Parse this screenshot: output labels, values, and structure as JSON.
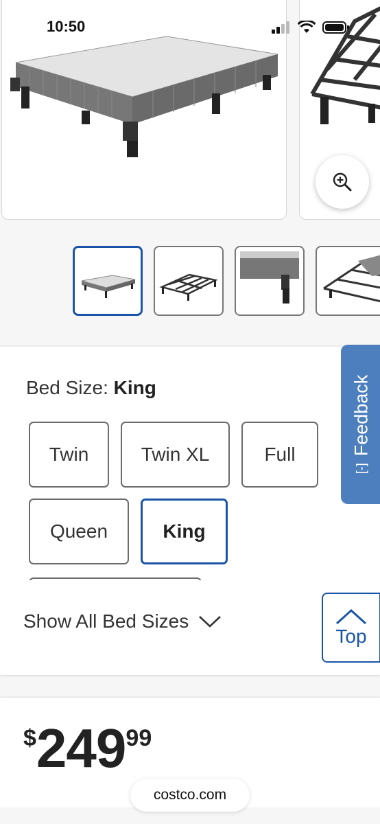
{
  "status_bar": {
    "time": "10:50"
  },
  "bed_size": {
    "label": "Bed Size:",
    "selected": "King",
    "options": [
      "Twin",
      "Twin XL",
      "Full",
      "Queen",
      "King"
    ],
    "show_all": "Show All Bed Sizes"
  },
  "feedback": {
    "label": "Feedback",
    "icon_text": "[-]"
  },
  "top_button": {
    "label": "Top"
  },
  "price": {
    "currency": "$",
    "whole": "249",
    "cents": "99"
  },
  "url_bar": {
    "domain": "costco.com"
  },
  "colors": {
    "accent": "#1a54a6",
    "feedback_bg": "#4d7fbf"
  }
}
